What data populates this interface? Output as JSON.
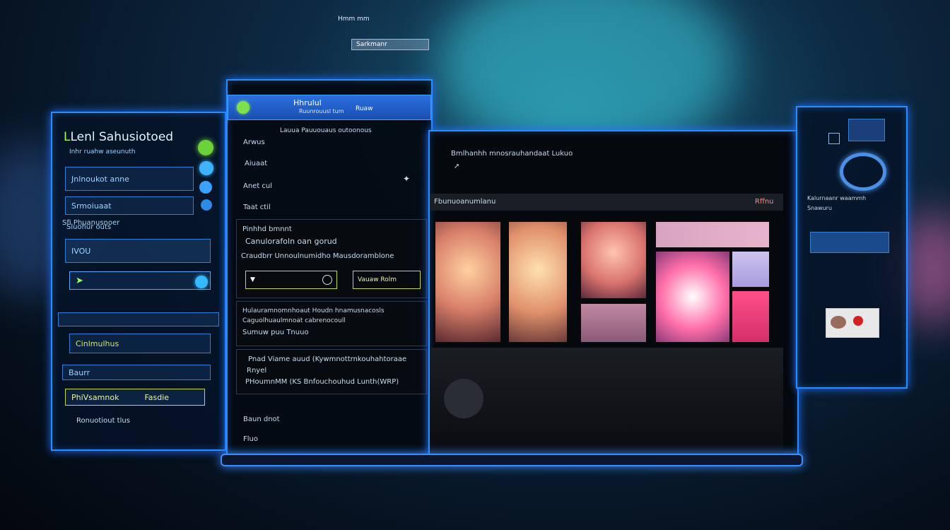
{
  "top_tabs": [
    "Hmm mm",
    "Sarkmanr"
  ],
  "left_panel": {
    "title": "Lenl Sahusiotoed",
    "subtitle": "Inhr ruahw aseunuth",
    "items": [
      "Jnlnoukot anne",
      "Srmoiuaat",
      "Sluohur outs",
      "IVOU"
    ],
    "section_label": "Sfi Phuanusnoer",
    "lower_items": [
      "Cinlmulhus",
      "Baurr",
      "PhiVsamnok",
      "Fasdie",
      "Ronuotiout tlus"
    ]
  },
  "middle_panel": {
    "header_title": "Hhrulul",
    "header_sub": "Ruunrouusl tum",
    "header_right": "Ruaw",
    "subheader": "Lauua Pauuouaus outoonous",
    "list_items": [
      "Arwus",
      "Aiuaat",
      "Anet cul",
      "Taat ctil"
    ],
    "block1_title": "Pinhhd bmnnt",
    "block1_line2": "Canulorafoln oan gorud",
    "block1_line3": "Craudbrr Unnoulnumidho Mausdoramblone",
    "btn1_label": "",
    "btn2_label": "Vauaw Rolm",
    "block2_line1": "Hulauramnomnhoaut Houdn hnamusnacosls",
    "block2_line2": "Caguolhuaulmnoat cabrenocoull",
    "block2_line3": "Sumuw puu Tnuuo",
    "block3_line1": "Pnad Viame auud (Kywmnottrnkouhahtoraae",
    "block3_line2": "Rnyel",
    "block3_line3": "PHoumnMM (KS Bnfouchouhud Lunth(WRP)",
    "footer1": "Baun dnot",
    "footer2": "Fluo"
  },
  "main_panel": {
    "header_text": "Bmlhanhh mnosrauhandaat Lukuo",
    "section_label": "Fbunuoanumlanu",
    "section_right": "Rffnu"
  },
  "right_panel": {
    "label1": "Kalurnaanr waammh",
    "label2": "Snawuru"
  },
  "colors": {
    "accent": "#2b8cff",
    "highlight": "#9dff6a"
  }
}
